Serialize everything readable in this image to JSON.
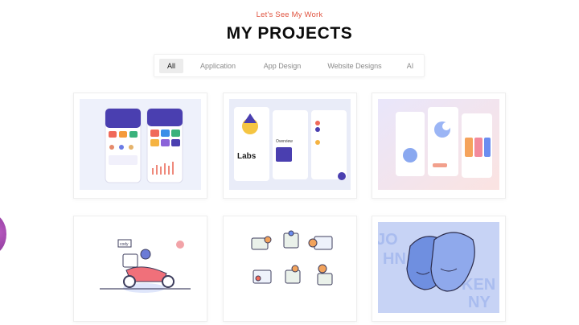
{
  "header": {
    "subtitle": "Let's See My Work",
    "title": "MY PROJECTS"
  },
  "filters": [
    {
      "label": "All",
      "active": true
    },
    {
      "label": "Application",
      "active": false
    },
    {
      "label": "App Design",
      "active": false
    },
    {
      "label": "Website Designs",
      "active": false
    },
    {
      "label": "AI",
      "active": false
    }
  ],
  "projects": [
    {
      "subject": "mobile app screens"
    },
    {
      "subject": "labs app screens",
      "thumb_text": "Labs",
      "thumb_heading": "Overview"
    },
    {
      "subject": "pastel app screens"
    },
    {
      "subject": "delivery scooter illustration",
      "thumb_text": "cody"
    },
    {
      "subject": "set of icons"
    },
    {
      "subject": "two faces illustration",
      "thumb_letters": [
        "JO",
        "HN",
        "KEN",
        "NY"
      ]
    }
  ],
  "colors": {
    "accent": "#e0533f",
    "title": "#0b0b0b",
    "filter_text": "#8a8a8a",
    "filter_active_bg": "#ececec",
    "app_purple": "#4a3fb0",
    "illustration_blue": "#5b7fd6"
  }
}
